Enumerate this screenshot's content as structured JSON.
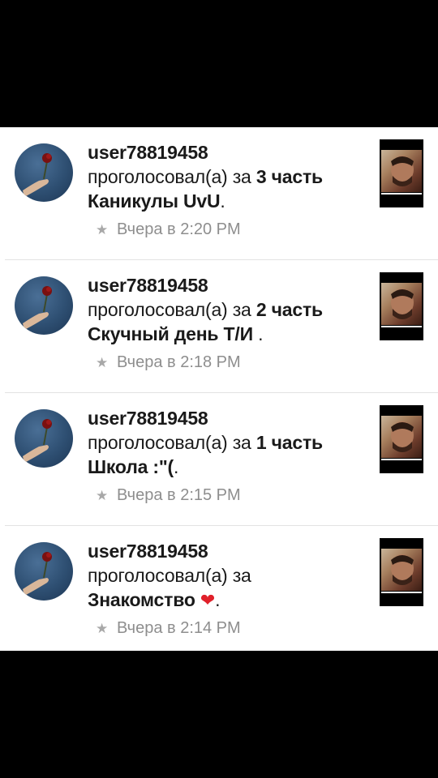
{
  "notifications": [
    {
      "username": "user78819458",
      "action": "проголосовал(а) за",
      "part": "3 часть",
      "story": "Каникулы UvU",
      "suffix": ".",
      "time": "Вчера в 2:20 PM"
    },
    {
      "username": "user78819458",
      "action": "проголосовал(а) за",
      "part": "2 часть",
      "story": "Скучный день Т/И",
      "suffix": " .",
      "time": "Вчера в 2:18 PM"
    },
    {
      "username": "user78819458",
      "action": "проголосовал(а) за",
      "part": "1 часть",
      "story": "Школа :\"(",
      "suffix": ".",
      "time": "Вчера в 2:15 PM"
    },
    {
      "username": "user78819458",
      "action": "проголосовал(а) за",
      "part": "",
      "story": "Знакомство",
      "heart": "❤",
      "suffix": ".",
      "time": "Вчера в 2:14 PM"
    }
  ],
  "icons": {
    "meta": "star-icon",
    "avatar": "rose-in-hand-avatar",
    "cover": "story-cover-thumbnail"
  },
  "colors": {
    "heart": "#e0202a",
    "meta_text": "#8e8e8e"
  }
}
